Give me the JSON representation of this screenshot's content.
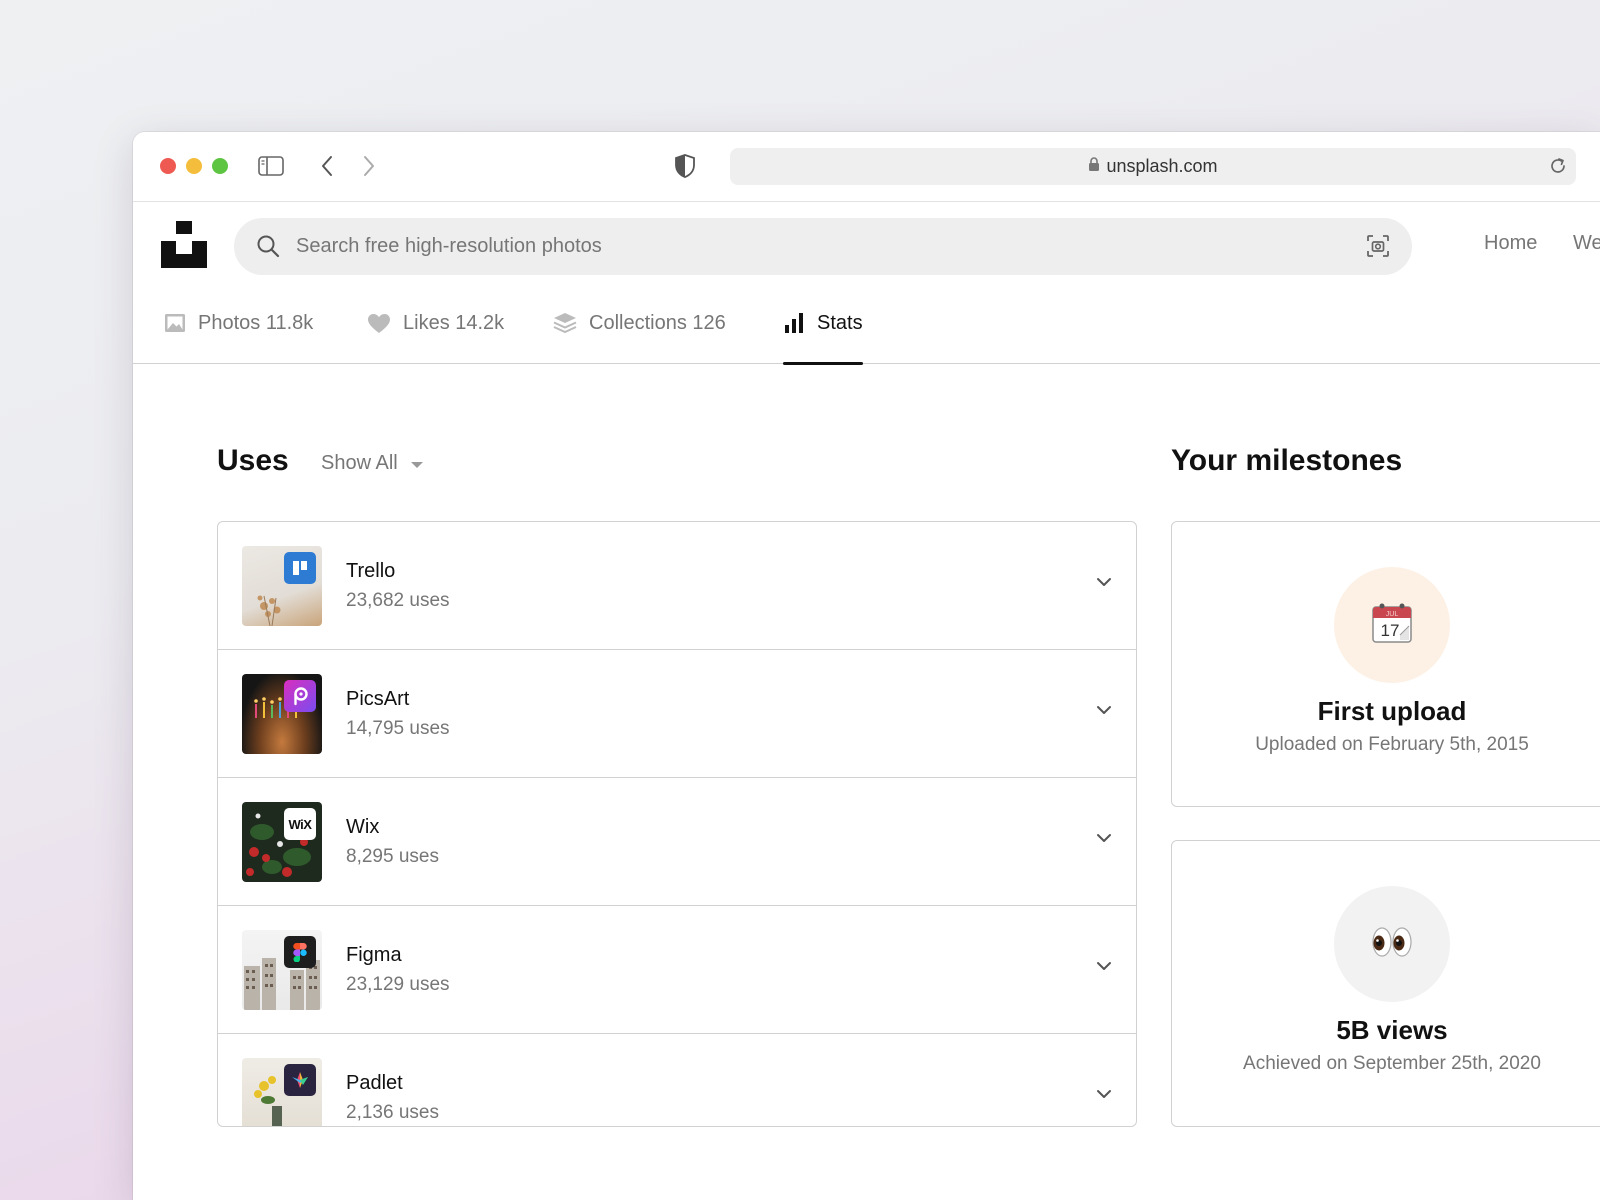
{
  "browser": {
    "url": "unsplash.com"
  },
  "search": {
    "placeholder": "Search free high-resolution photos"
  },
  "nav": {
    "home": "Home",
    "partial": "We"
  },
  "tabs": [
    {
      "label": "Photos 11.8k",
      "icon": "image-icon"
    },
    {
      "label": "Likes 14.2k",
      "icon": "heart-icon"
    },
    {
      "label": "Collections 126",
      "icon": "layers-icon"
    },
    {
      "label": "Stats",
      "icon": "bar-chart-icon",
      "active": true
    }
  ],
  "uses": {
    "title": "Uses",
    "filter": "Show All",
    "items": [
      {
        "name": "Trello",
        "count": "23,682 uses",
        "app_icon": "trello-icon"
      },
      {
        "name": "PicsArt",
        "count": "14,795 uses",
        "app_icon": "picsart-icon"
      },
      {
        "name": "Wix",
        "count": "8,295 uses",
        "app_icon": "wix-icon",
        "badge_text": "WiX"
      },
      {
        "name": "Figma",
        "count": "23,129 uses",
        "app_icon": "figma-icon"
      },
      {
        "name": "Padlet",
        "count": "2,136 uses",
        "app_icon": "padlet-icon"
      }
    ]
  },
  "milestones": {
    "title": "Your milestones",
    "items": [
      {
        "name": "First upload",
        "detail": "Uploaded on February 5th, 2015",
        "icon": "calendar-icon",
        "calendar_month": "JUL",
        "calendar_day": "17",
        "circle_color": "#fdf1e6"
      },
      {
        "name": "5B views",
        "detail": "Achieved on September 25th, 2020",
        "icon": "eyes-icon",
        "circle_color": "#f2f2f2"
      }
    ]
  },
  "colors": {
    "text_primary": "#111111",
    "text_secondary": "#767676",
    "border": "#d1d1d1"
  }
}
